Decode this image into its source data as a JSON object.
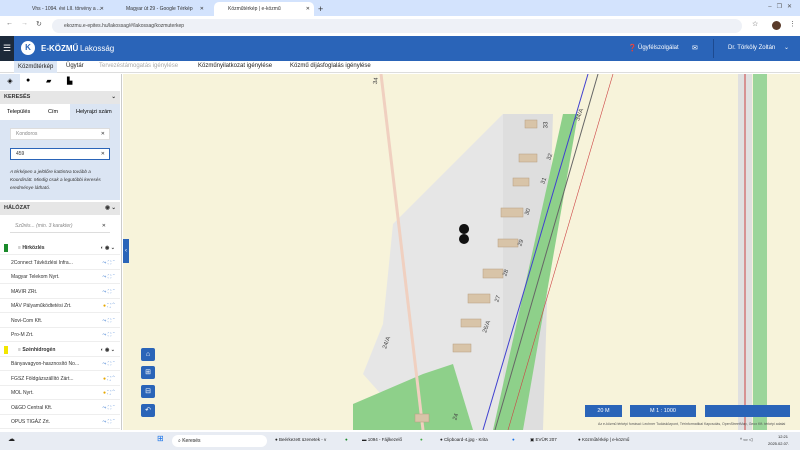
{
  "browser": {
    "tabs": [
      {
        "label": "Vhs - 1094. évi LII. törvény a ...",
        "active": false
      },
      {
        "label": "Magyar út 29 - Google Térkép",
        "active": false
      },
      {
        "label": "Közműtérkép | e-közmű",
        "active": true
      }
    ],
    "new_tab": "+",
    "url": "ekozmu.e-epites.hu/lakossag/#/lakossag/kozmuterkep"
  },
  "app": {
    "logo": "K",
    "brand": "E-KÖZMŰ",
    "brand_sub": "Lakosság",
    "support": "Ügyfélszolgálat",
    "user": "Dr. Törköly Zoltán"
  },
  "nav": [
    "Közműtérkép",
    "Ügytár",
    "Tervezéstámogatás igénylése",
    "Közműnyilatkozat igénylése",
    "Közmű díjásfoglalás igénylése"
  ],
  "sidebar": {
    "search_title": "KERESÉS",
    "search_tabs": [
      "Település",
      "Cím",
      "Helyrajzi szám"
    ],
    "settlement_value": "Kondoros",
    "parcel_value": "459",
    "help_text": "A térképen a jelölőre kattintva tovább a Koordinátt. Mindig csak a legutóbbi keresés eredménye látható.",
    "network_title": "HÁLÓZAT",
    "filter_placeholder": "Szűrés... (min. 3 karakter)",
    "groups": [
      {
        "name": "Hírközlés",
        "color": "#1a8a2a",
        "items": [
          {
            "label": "2Connect Távközlési Infra...",
            "warn": false
          },
          {
            "label": "Magyar Telekom Nyrt.",
            "warn": false
          },
          {
            "label": "MAVIR ZRt.",
            "warn": false
          },
          {
            "label": "MÁV Pályaműködtetési Zrt.",
            "warn": true
          },
          {
            "label": "Novi-Com Kft.",
            "warn": false
          },
          {
            "label": "Pro-M Zrt.",
            "warn": false
          }
        ]
      },
      {
        "name": "Szénhidrogén",
        "color": "#f2e600",
        "items": [
          {
            "label": "Bányavagyon-hasznosító No...",
            "warn": false
          },
          {
            "label": "FGSZ Földgázszállító Zárt...",
            "warn": true
          },
          {
            "label": "MOL Nyrt.",
            "warn": true
          },
          {
            "label": "O&GD Central Kft.",
            "warn": false
          },
          {
            "label": "OPUS TIGÁZ Zrt.",
            "warn": false
          }
        ]
      }
    ]
  },
  "map": {
    "house_numbers": [
      "34",
      "34/A",
      "33",
      "32",
      "31",
      "30",
      "29",
      "28",
      "27",
      "26/A",
      "24/A",
      "24"
    ],
    "scale": "20 M",
    "ratio": "M  1 : 1000",
    "attribution": "Az e-közmű térképi forrásai: Lechner Tudásközpont, Térinformatikai Kapcsolás, OpenStreetMap, Geox Kft. térképi adatai"
  },
  "taskbar": {
    "search": "Keresés",
    "apps": [
      "Beérkezett üzenetek - v",
      "1094 - Fájlkezelő",
      "Clipboard-4.jpg - Krita",
      "EVÜR 207",
      "Közműtérkép | e-közmű"
    ],
    "time": "12:21",
    "date": "2025.02.07."
  }
}
